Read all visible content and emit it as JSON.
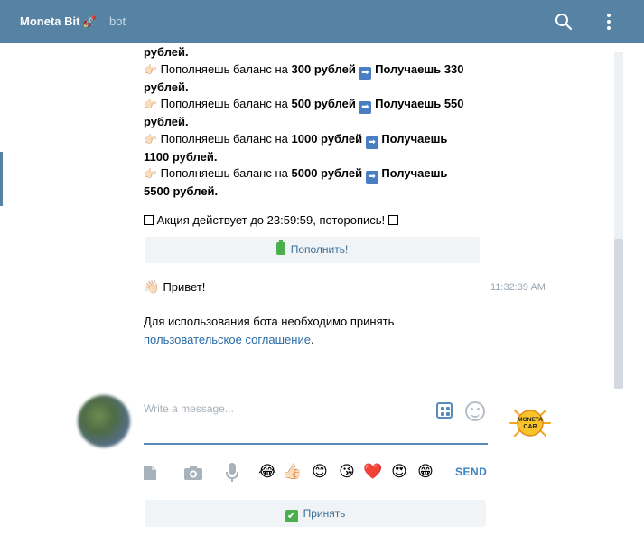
{
  "header": {
    "title": "Moneta Bit",
    "subtitle": "bot"
  },
  "promo": {
    "line0": "рублей.",
    "items": [
      {
        "pre": "Пополняешь баланс на",
        "amount": "300 рублей",
        "get": "Получаешь 330",
        "tail": "рублей."
      },
      {
        "pre": "Пополняешь баланс на",
        "amount": "500 рублей",
        "get": "Получаешь 550",
        "tail": "рублей."
      },
      {
        "pre": "Пополняешь баланс на",
        "amount": "1000 рублей",
        "get": "Получаешь",
        "tail": "1100 рублей."
      },
      {
        "pre": "Пополняешь баланс на",
        "amount": "5000 рублей",
        "get": "Получаешь",
        "tail": "5500 рублей."
      }
    ],
    "action": "Акция действует до 23:59:59, пото%",
    "action_text": "Акция действует до 23:59:59, поторопись!"
  },
  "topup_button": "Пополнить!",
  "hello": {
    "text": "Привет!",
    "time": "11:32:39 AM"
  },
  "agreement": {
    "text": "Для использования бота необходимо принять",
    "link": "пользовательское соглашение",
    "suffix": "."
  },
  "composer": {
    "placeholder": "Write a message...",
    "send": "SEND",
    "logo_text": "MONETA CAR"
  },
  "accept_button": "Принять",
  "colors": {
    "header": "#5682a3",
    "link": "#2a6ba8",
    "send": "#3a83c4"
  }
}
